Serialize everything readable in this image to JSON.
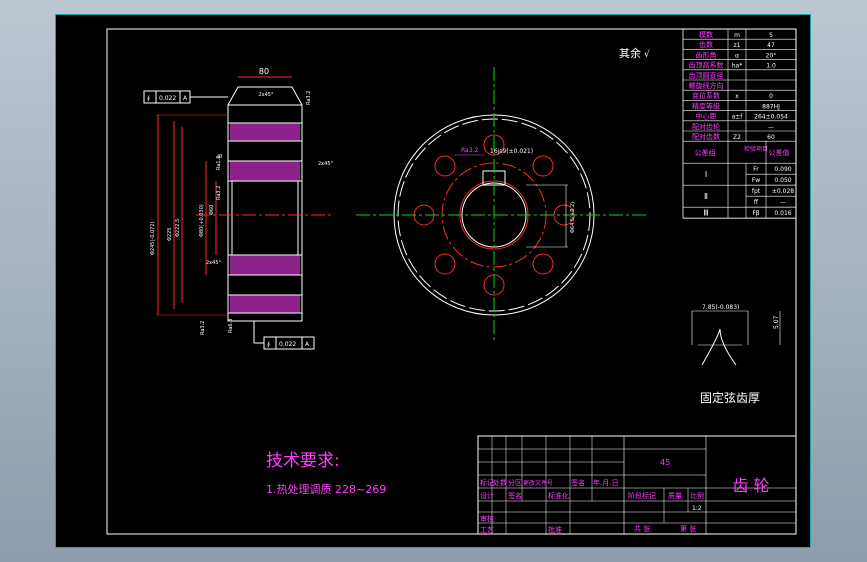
{
  "title_block": {
    "part_name": "齿 轮",
    "material": "45",
    "header_row": [
      "标记",
      "处数",
      "分区",
      "更改文件号",
      "签名",
      "年.月.日"
    ],
    "design_row": [
      "设计",
      "签名",
      "",
      "标准化"
    ],
    "check_label": "审核",
    "process_label": "工艺",
    "approve_label": "批准",
    "stage_labels": [
      "阶段标记",
      "质量",
      "比例"
    ],
    "scale": "1:2",
    "sheet_total": "共 张",
    "sheet_num": "第 张"
  },
  "params": {
    "rows": [
      {
        "name": "模数",
        "sym": "m",
        "val": "5"
      },
      {
        "name": "齿数",
        "sym": "z1",
        "val": "47"
      },
      {
        "name": "齿形角",
        "sym": "α",
        "val": "20°"
      },
      {
        "name": "齿顶高系数",
        "sym": "ha*",
        "val": "1.0"
      },
      {
        "name": "齿顶圆直径",
        "sym": "",
        "val": ""
      },
      {
        "name": "螺旋线方向",
        "sym": "",
        "val": ""
      },
      {
        "name": "变位系数",
        "sym": "x",
        "val": "0"
      },
      {
        "name": "精度等级",
        "sym": "",
        "val": "887HJ"
      },
      {
        "name": "中心距",
        "sym": "a±f",
        "val": "264±0.054"
      },
      {
        "name": "配对齿轮",
        "sym": "",
        "val": "—"
      },
      {
        "name": "配对齿数",
        "sym": "Z2",
        "val": "60"
      }
    ],
    "tol_header": [
      "公差组",
      "检验项目",
      "公差值"
    ],
    "tol_rows": [
      {
        "group": "Ⅰ",
        "items": [
          {
            "sym": "Fr",
            "val": "0.090"
          },
          {
            "sym": "Fw",
            "val": "0.050"
          }
        ]
      },
      {
        "group": "Ⅱ",
        "items": [
          {
            "sym": "fpt",
            "val": "±0.028"
          },
          {
            "sym": "ff",
            "val": "—"
          }
        ]
      },
      {
        "group": "Ⅲ",
        "items": [
          {
            "sym": "Fβ",
            "val": "0.016"
          }
        ]
      }
    ]
  },
  "notes": {
    "title": "技术要求:",
    "line1": "1.热处理调质 228~269"
  },
  "labels": {
    "roughness_other": "其余",
    "chordal": "固定弦齿厚",
    "chordal_dim1": "7.85(-0.083)",
    "chordal_dim2": "5.07",
    "top_width": "80",
    "chamfer1": "2x45°",
    "chamfer2": "2x45°",
    "chamfer3": "2x45°",
    "tol_top": "0.022",
    "tol_bottom": "0.022",
    "datum_top": "A",
    "datum_bottom": "A",
    "dia1": "Φ245(-0.072)",
    "dia2": "Φ225",
    "dia3": "Φ222.5",
    "dia4": "Φ80(+0.030)",
    "dia5": "Φ60",
    "keyway": "16js9(±0.021)",
    "bore_dim": "Φ64.5(+0.2)",
    "rough1": "Ra3.2",
    "rough2": "Ra1.6",
    "rough3": "Ra3.2",
    "rough4": "Ra3.2",
    "rough5": "Ra6.3",
    "key_rough": "Ra3.2",
    "datum_mark": "B"
  }
}
